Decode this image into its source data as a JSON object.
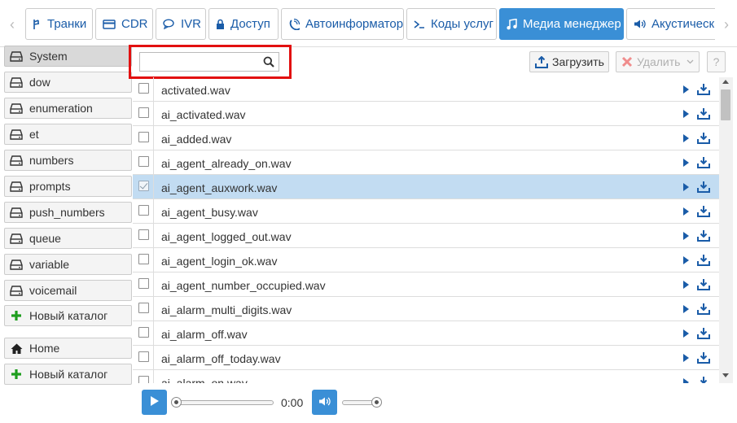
{
  "tabs": [
    {
      "label": "Транки",
      "icon": "trunk-icon"
    },
    {
      "label": "CDR",
      "icon": "card-icon"
    },
    {
      "label": "IVR",
      "icon": "chat-icon"
    },
    {
      "label": "Доступ",
      "icon": "lock-icon"
    },
    {
      "label": "Автоинформатор",
      "icon": "phone-ring-icon"
    },
    {
      "label": "Коды услуг",
      "icon": "terminal-icon"
    },
    {
      "label": "Медиа менеджер",
      "icon": "music-icon",
      "active": true
    },
    {
      "label": "Акустически",
      "icon": "volume-icon"
    }
  ],
  "sidebar": {
    "folders": [
      {
        "label": "System",
        "selected": true
      },
      {
        "label": "dow"
      },
      {
        "label": "enumeration"
      },
      {
        "label": "et"
      },
      {
        "label": "numbers"
      },
      {
        "label": "prompts"
      },
      {
        "label": "push_numbers"
      },
      {
        "label": "queue"
      },
      {
        "label": "variable"
      },
      {
        "label": "voicemail"
      }
    ],
    "new_folder_label": "Новый каталог",
    "home_label": "Home",
    "new_folder_label_2": "Новый каталог"
  },
  "search": {
    "value": "",
    "placeholder": ""
  },
  "toolbar": {
    "upload_label": "Загрузить",
    "delete_label": "Удалить",
    "help_label": "?"
  },
  "files": [
    {
      "name": "activated.wav",
      "checked": false
    },
    {
      "name": "ai_activated.wav",
      "checked": false
    },
    {
      "name": "ai_added.wav",
      "checked": false
    },
    {
      "name": "ai_agent_already_on.wav",
      "checked": false
    },
    {
      "name": "ai_agent_auxwork.wav",
      "checked": true
    },
    {
      "name": "ai_agent_busy.wav",
      "checked": false
    },
    {
      "name": "ai_agent_logged_out.wav",
      "checked": false
    },
    {
      "name": "ai_agent_login_ok.wav",
      "checked": false
    },
    {
      "name": "ai_agent_number_occupied.wav",
      "checked": false
    },
    {
      "name": "ai_alarm_multi_digits.wav",
      "checked": false
    },
    {
      "name": "ai_alarm_off.wav",
      "checked": false
    },
    {
      "name": "ai_alarm_off_today.wav",
      "checked": false
    },
    {
      "name": "ai_alarm_on.wav",
      "checked": false
    }
  ],
  "player": {
    "time": "0:00",
    "progress": 0,
    "volume": 1.0
  },
  "colors": {
    "accent": "#3a8fd6",
    "link": "#1a5ca8",
    "selected_row": "#c2dcf2",
    "highlight": "#e21010",
    "green": "#1e9e1e"
  }
}
